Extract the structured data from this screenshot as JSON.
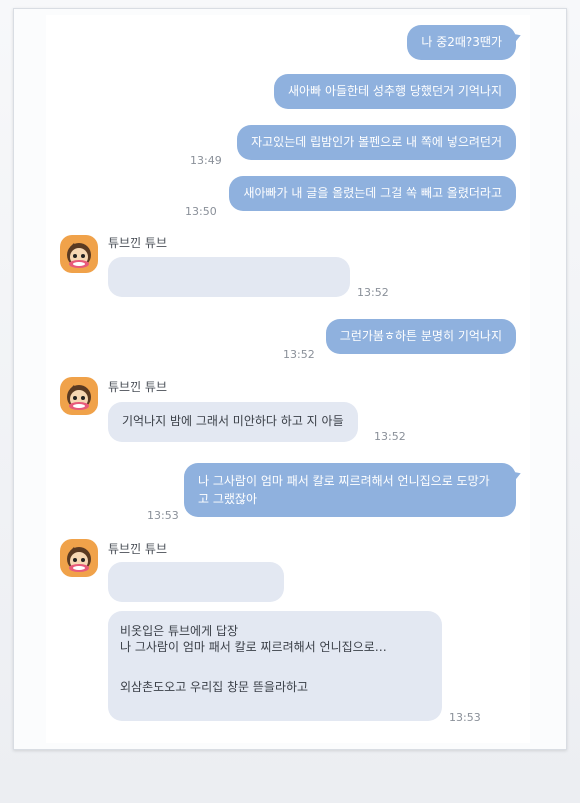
{
  "messages": {
    "out1": {
      "text": "나 중2때?3땐가"
    },
    "out2": {
      "text": "새아빠 아들한테 성추행 당했던거 기억나지"
    },
    "out3": {
      "text": "자고있는데 립밤인가 볼펜으로 내 쪽에 넣으려던거",
      "time": "13:49"
    },
    "out4": {
      "text": "새아빠가 내 글을 올렸는데 그걸 쏙 빼고 올렸더라고",
      "time": "13:50"
    },
    "in1": {
      "name": "튜브낀 튜브",
      "text": "",
      "time": "13:52"
    },
    "out5": {
      "text": "그런가봄ㅎ하튼 분명히 기억나지",
      "time": "13:52"
    },
    "in2": {
      "name": "튜브낀 튜브",
      "text": "기억나지 밤에 그래서 미안하다 하고 지 아들",
      "time": "13:52"
    },
    "out6": {
      "line1": "나 그사람이 엄마 패서 칼로 찌르려해서 언니집으로 도망가",
      "line2": "고 그랬잖아",
      "time": "13:53"
    },
    "in3": {
      "name": "튜브낀 튜브",
      "text": "",
      "reply_header": "비옷입은 튜브에게 답장",
      "reply_quote": "나 그사람이 엄마 패서 칼로 찌르려해서 언니집으로…",
      "reply_text": "외삼촌도오고 우리집 창문 뜯을라하고",
      "time": "13:53"
    }
  },
  "colors": {
    "outgoing_bubble": "#8fb1de",
    "incoming_bubble": "#e3e8f2",
    "avatar_bg": "#f0a24a"
  },
  "icons": {
    "avatar": "tube-character-avatar-icon"
  }
}
